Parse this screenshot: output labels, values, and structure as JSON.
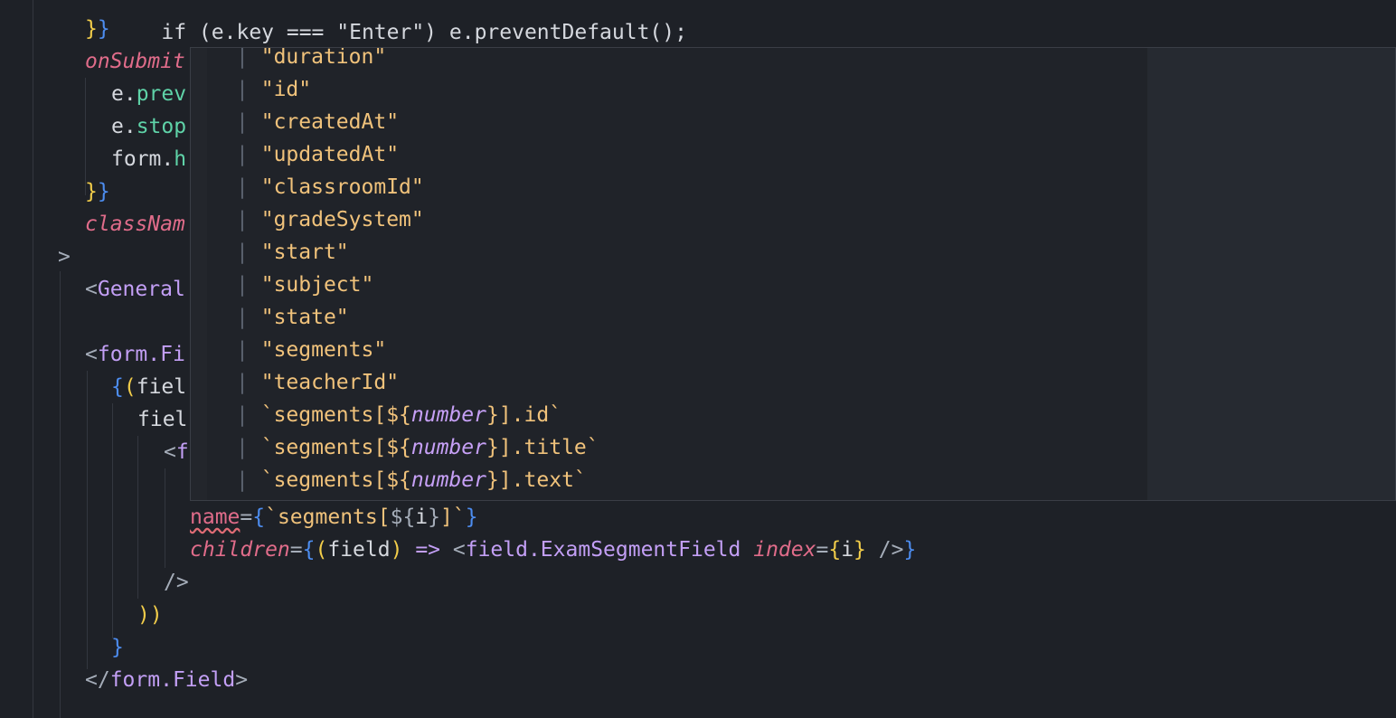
{
  "code_lines": [
    {
      "name": "line-key-enter",
      "tokens": [
        "if (e.key === \"Enter\") e.preventDefault();"
      ]
    },
    {
      "name": "line-close-1",
      "tokens": [
        "}",
        "}"
      ]
    },
    {
      "name": "line-onsubmit",
      "tokens": [
        "onSubmit"
      ]
    },
    {
      "name": "line-prev",
      "tokens": [
        "e.",
        "prev"
      ]
    },
    {
      "name": "line-stop",
      "tokens": [
        "e.",
        "stop"
      ]
    },
    {
      "name": "line-form-h",
      "tokens": [
        "form.",
        "h"
      ]
    },
    {
      "name": "line-close-2",
      "tokens": [
        "}",
        "}"
      ]
    },
    {
      "name": "line-classname",
      "tokens": [
        "classNam"
      ]
    },
    {
      "name": "line-gt",
      "tokens": [
        ">"
      ]
    },
    {
      "name": "line-general",
      "tokens": [
        "<",
        "General"
      ]
    },
    {
      "name": "line-form-fi",
      "tokens": [
        "<",
        "form.Fi"
      ]
    },
    {
      "name": "line-fiel-1",
      "tokens": [
        "{",
        "(",
        "fiel"
      ]
    },
    {
      "name": "line-fiel-2",
      "tokens": [
        "fiel"
      ]
    },
    {
      "name": "line-f",
      "tokens": [
        "<",
        "f"
      ]
    },
    {
      "name": "line-name-attr",
      "tokens": [
        "name",
        "=",
        "{",
        "`segments[",
        "${",
        "i",
        "}",
        "]`",
        "}"
      ]
    },
    {
      "name": "line-children-attr",
      "tokens": [
        "children",
        "=",
        "{",
        "(",
        "field",
        ")",
        " => ",
        "<",
        "field.ExamSegmentField",
        " ",
        "index",
        "=",
        "{",
        "i",
        "}",
        " />",
        "}"
      ]
    },
    {
      "name": "line-selfclose",
      "tokens": [
        "/>"
      ]
    },
    {
      "name": "line-parens",
      "tokens": [
        ")",
        ")"
      ]
    },
    {
      "name": "line-close-3",
      "tokens": [
        "}"
      ]
    },
    {
      "name": "line-form-close",
      "tokens": [
        "</",
        "form.Field",
        ">"
      ]
    }
  ],
  "popup": {
    "pipe": "|",
    "options": [
      "\"duration\"",
      "\"id\"",
      "\"createdAt\"",
      "\"updatedAt\"",
      "\"classroomId\"",
      "\"gradeSystem\"",
      "\"start\"",
      "\"subject\"",
      "\"state\"",
      "\"segments\"",
      "\"teacherId\""
    ],
    "template_options": [
      {
        "prefix": "`segments[${",
        "var": "number",
        "suffix": "}].id`"
      },
      {
        "prefix": "`segments[${",
        "var": "number",
        "suffix": "}].title`"
      },
      {
        "prefix": "`segments[${",
        "var": "number",
        "suffix": "}].text`"
      }
    ]
  }
}
